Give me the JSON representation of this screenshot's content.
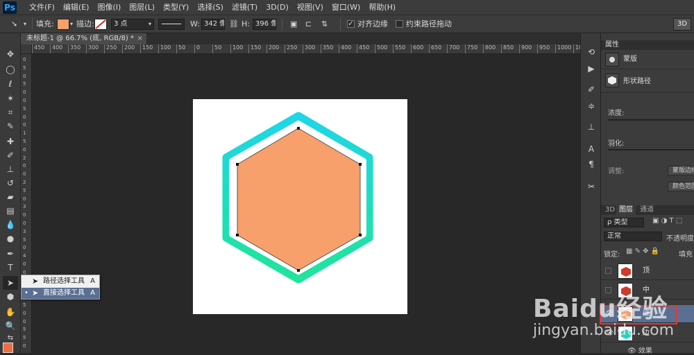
{
  "app": {
    "logo": "Ps"
  },
  "menu": [
    "文件(F)",
    "编辑(E)",
    "图像(I)",
    "图层(L)",
    "类型(Y)",
    "选择(S)",
    "滤镜(T)",
    "3D(D)",
    "视图(V)",
    "窗口(W)",
    "帮助(H)"
  ],
  "options_bar": {
    "fill_label": "填充:",
    "fill_color": "#f7a06b",
    "stroke_label": "描边:",
    "stroke_width": "3 点",
    "width_label": "W:",
    "width_value": "342 像",
    "height_label": "H:",
    "height_value": "396 像",
    "align_edges_checked": true,
    "align_edges_label": "对齐边缘",
    "constrain_path_checked": false,
    "constrain_path_label": "约束路径拖动",
    "mode_3d": "3D"
  },
  "document": {
    "tab_title": "未标题-1 @ 66.7% (底, RGB/8) *",
    "close_glyph": "×"
  },
  "rulers": {
    "horizontal": [
      "450",
      "400",
      "350",
      "300",
      "250",
      "200",
      "150",
      "100",
      "50",
      "0",
      "50",
      "100",
      "150",
      "200",
      "250",
      "300",
      "350",
      "400",
      "450",
      "500",
      "550",
      "600",
      "650",
      "700",
      "750",
      "800",
      "850",
      "900",
      "950",
      "1000",
      "1050"
    ],
    "vertical": [
      "0",
      "5",
      "0",
      "5",
      "0",
      "0",
      "5",
      "0",
      "0",
      "1",
      "5",
      "0",
      "2",
      "0",
      "0",
      "2",
      "5",
      "0",
      "3",
      "0",
      "0",
      "3",
      "5",
      "0",
      "4",
      "0",
      "0",
      "4",
      "5",
      "0",
      "5",
      "0",
      "0",
      "5",
      "5",
      "0"
    ]
  },
  "canvas": {
    "fill_color": "#f7a06b",
    "outline_gradient_top": "#1ed6e6",
    "outline_gradient_bottom": "#1fe49a"
  },
  "flyout": {
    "items": [
      {
        "label": "路径选择工具",
        "shortcut": "A",
        "icon": "path-selection-icon",
        "selected": false
      },
      {
        "label": "直接选择工具",
        "shortcut": "A",
        "icon": "direct-selection-icon",
        "selected": true
      }
    ],
    "bullet": "•"
  },
  "properties": {
    "title": "属性",
    "mask_label": "蒙版",
    "shape_path_label": "形状路径",
    "density_label": "浓度:",
    "feather_label": "羽化:",
    "adjust_label": "调整:",
    "btn_mask_edge": "蒙版边缘",
    "btn_color_range": "颜色范围"
  },
  "layers": {
    "tabs": [
      "3D",
      "图层",
      "通道"
    ],
    "kind_filter": "ρ 类型",
    "blend_mode": "正常",
    "opacity_label": "不透明度:",
    "lock_label": "锁定:",
    "fill_label": "填充",
    "list": [
      {
        "name": "顶",
        "selected": false
      },
      {
        "name": "中",
        "selected": false
      },
      {
        "name": "底",
        "selected": true
      },
      {
        "name": "边",
        "selected": false
      }
    ],
    "effects_label": "效果"
  },
  "watermark": {
    "logo_text": "Baidu经验",
    "url": "jingyan.baidu.com"
  }
}
